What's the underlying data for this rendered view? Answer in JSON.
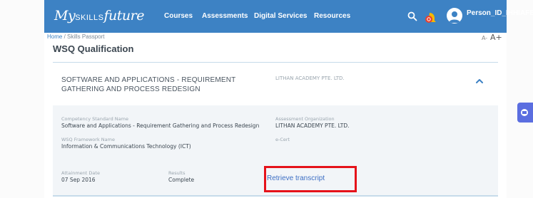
{
  "header": {
    "logo_prefix": "My",
    "logo_middle": "SKILLS",
    "logo_suffix": "future",
    "nav": [
      {
        "label": "Courses"
      },
      {
        "label": "Assessments"
      },
      {
        "label": "Digital Services"
      },
      {
        "label": "Resources"
      }
    ],
    "username": "Person_ID_IHHIAFB",
    "colors": {
      "bar": "#3d82c4",
      "notification_dot": "#e8402f",
      "bell": "#f5b800"
    }
  },
  "subbar": {
    "breadcrumb_home": "Home",
    "breadcrumb_sep": " / ",
    "breadcrumb_current": "Skills Passport",
    "font_small": "A-",
    "font_large": "A+"
  },
  "page": {
    "title": "WSQ Qualification"
  },
  "card": {
    "title": "SOFTWARE AND APPLICATIONS - REQUIREMENT GATHERING AND PROCESS REDESIGN",
    "provider": "LITHAN ACADEMY PTE. LTD.",
    "fields": {
      "competency_label": "Competency Standard Name",
      "competency_value": "Software and Applications - Requirement Gathering and Process Redesign",
      "assessment_org_label": "Assessment Organization",
      "assessment_org_value": "LITHAN ACADEMY PTE. LTD.",
      "framework_label": "WSQ Framework Name",
      "framework_value": "Information & Communications Technology (ICT)",
      "ecert_label": "e-Cert",
      "attainment_label": "Attainment Date",
      "attainment_value": "07 Sep 2016",
      "results_label": "Results",
      "results_value": "Complete"
    },
    "transcript_link": "Retrieve transcript",
    "highlight_color": "#e5121a"
  }
}
